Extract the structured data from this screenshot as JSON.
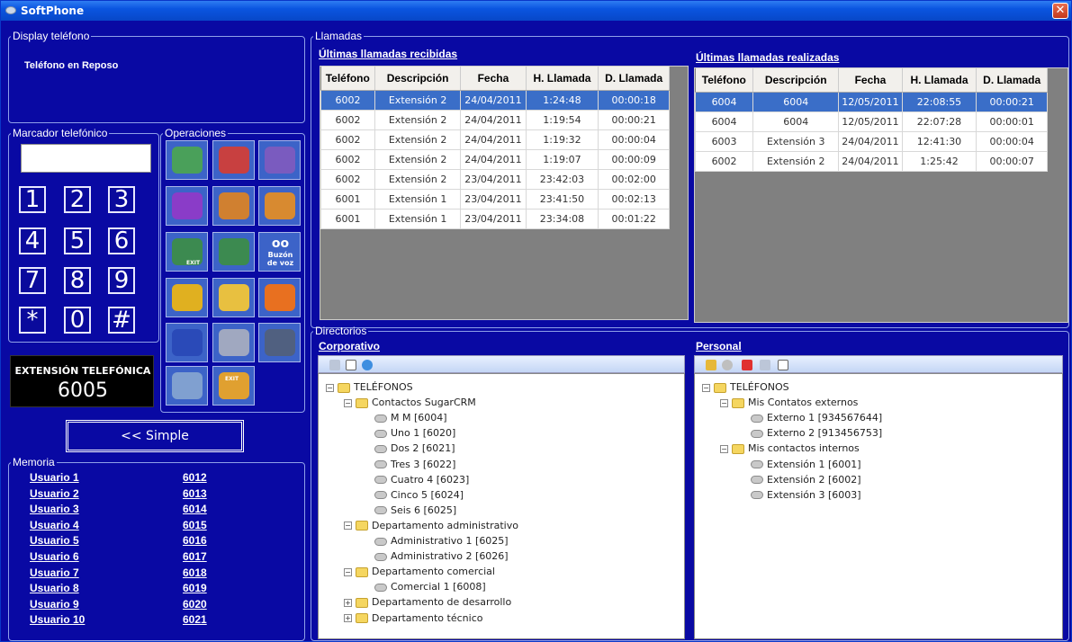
{
  "window": {
    "title": "SoftPhone",
    "close": "✕"
  },
  "display": {
    "legend": "Display teléfono",
    "status": "Teléfono en Reposo"
  },
  "dialer": {
    "legend": "Marcador telefónico",
    "keys": [
      "1",
      "2",
      "3",
      "4",
      "5",
      "6",
      "7",
      "8",
      "9",
      "*",
      "0",
      "#"
    ]
  },
  "operations": {
    "legend": "Operaciones",
    "voicemail_label_1": "Buzón",
    "voicemail_label_2": "de voz",
    "exit_small": "EXIT",
    "exit_big": "EXIT",
    "icons": [
      "answer-call-icon",
      "hangup-call-icon",
      "redial-icon",
      "hold-icon",
      "transfer-icon",
      "forward-icon",
      "transfer-exit-icon",
      "conference-icon",
      "voicemail-icon",
      "add-contact-icon",
      "address-book-icon",
      "alert-icon",
      "park-call-icon",
      "settings-icon",
      "mute-icon",
      "search-icon",
      "exit-icon"
    ]
  },
  "extension": {
    "label": "EXTENSIÓN TELEFÓNICA",
    "number": "6005"
  },
  "simple_button": "<< Simple",
  "memory": {
    "legend": "Memoria",
    "rows": [
      {
        "name": "Usuario 1",
        "num": "6012"
      },
      {
        "name": "Usuario 2",
        "num": "6013"
      },
      {
        "name": "Usuario 3",
        "num": "6014"
      },
      {
        "name": "Usuario 4",
        "num": "6015"
      },
      {
        "name": "Usuario 5",
        "num": "6016"
      },
      {
        "name": "Usuario 6",
        "num": "6017"
      },
      {
        "name": "Usuario 7",
        "num": "6018"
      },
      {
        "name": "Usuario 8",
        "num": "6019"
      },
      {
        "name": "Usuario 9",
        "num": "6020"
      },
      {
        "name": "Usuario 10",
        "num": "6021"
      }
    ]
  },
  "calls": {
    "legend": "Llamadas",
    "headers": [
      "Teléfono",
      "Descripción",
      "Fecha",
      "H. Llamada",
      "D. Llamada"
    ],
    "received": {
      "title": "Últimas llamadas recibidas",
      "rows": [
        [
          "6002",
          "Extensión 2",
          "24/04/2011",
          "1:24:48",
          "00:00:18"
        ],
        [
          "6002",
          "Extensión 2",
          "24/04/2011",
          "1:19:54",
          "00:00:21"
        ],
        [
          "6002",
          "Extensión 2",
          "24/04/2011",
          "1:19:32",
          "00:00:04"
        ],
        [
          "6002",
          "Extensión 2",
          "24/04/2011",
          "1:19:07",
          "00:00:09"
        ],
        [
          "6002",
          "Extensión 2",
          "23/04/2011",
          "23:42:03",
          "00:02:00"
        ],
        [
          "6001",
          "Extensión 1",
          "23/04/2011",
          "23:41:50",
          "00:02:13"
        ],
        [
          "6001",
          "Extensión 1",
          "23/04/2011",
          "23:34:08",
          "00:01:22"
        ]
      ]
    },
    "made": {
      "title": "Últimas llamadas realizadas",
      "rows": [
        [
          "6004",
          "6004",
          "12/05/2011",
          "22:08:55",
          "00:00:21"
        ],
        [
          "6004",
          "6004",
          "12/05/2011",
          "22:07:28",
          "00:00:01"
        ],
        [
          "6003",
          "Extensión 3",
          "24/04/2011",
          "12:41:30",
          "00:00:04"
        ],
        [
          "6002",
          "Extensión 2",
          "24/04/2011",
          "1:25:42",
          "00:00:07"
        ]
      ]
    }
  },
  "directories": {
    "legend": "Directorios",
    "corporate": {
      "title": "Corporativo",
      "tree": [
        {
          "t": "TELÉFONOS",
          "lvl": 0,
          "pm": "−",
          "kind": "folder"
        },
        {
          "t": "Contactos SugarCRM",
          "lvl": 1,
          "pm": "−",
          "kind": "folder"
        },
        {
          "t": "M M [6004]",
          "lvl": 2,
          "kind": "leaf"
        },
        {
          "t": "Uno 1 [6020]",
          "lvl": 2,
          "kind": "leaf"
        },
        {
          "t": "Dos 2 [6021]",
          "lvl": 2,
          "kind": "leaf"
        },
        {
          "t": "Tres 3 [6022]",
          "lvl": 2,
          "kind": "leaf"
        },
        {
          "t": "Cuatro 4 [6023]",
          "lvl": 2,
          "kind": "leaf"
        },
        {
          "t": "Cinco 5 [6024]",
          "lvl": 2,
          "kind": "leaf"
        },
        {
          "t": "Seis 6 [6025]",
          "lvl": 2,
          "kind": "leaf"
        },
        {
          "t": "Departamento administrativo",
          "lvl": 1,
          "pm": "−",
          "kind": "folder"
        },
        {
          "t": "Administrativo 1 [6025]",
          "lvl": 2,
          "kind": "leaf"
        },
        {
          "t": "Administrativo 2 [6026]",
          "lvl": 2,
          "kind": "leaf"
        },
        {
          "t": "Departamento comercial",
          "lvl": 1,
          "pm": "−",
          "kind": "folder"
        },
        {
          "t": "Comercial 1 [6008]",
          "lvl": 2,
          "kind": "leaf"
        },
        {
          "t": "Departamento de desarrollo",
          "lvl": 1,
          "pm": "+",
          "kind": "folder"
        },
        {
          "t": "Departamento técnico",
          "lvl": 1,
          "pm": "+",
          "kind": "folder"
        }
      ]
    },
    "personal": {
      "title": "Personal",
      "tree": [
        {
          "t": "TELÉFONOS",
          "lvl": 0,
          "pm": "−",
          "kind": "folder"
        },
        {
          "t": "Mis Contatos externos",
          "lvl": 1,
          "pm": "−",
          "kind": "folder"
        },
        {
          "t": "Externo 1 [934567644]",
          "lvl": 2,
          "kind": "leaf"
        },
        {
          "t": "Externo 2 [913456753]",
          "lvl": 2,
          "kind": "leaf"
        },
        {
          "t": "Mis contactos internos",
          "lvl": 1,
          "pm": "−",
          "kind": "folder"
        },
        {
          "t": "Extensión 1 [6001]",
          "lvl": 2,
          "kind": "leaf"
        },
        {
          "t": "Extensión 2 [6002]",
          "lvl": 2,
          "kind": "leaf"
        },
        {
          "t": "Extensión 3 [6003]",
          "lvl": 2,
          "kind": "leaf"
        }
      ]
    }
  }
}
